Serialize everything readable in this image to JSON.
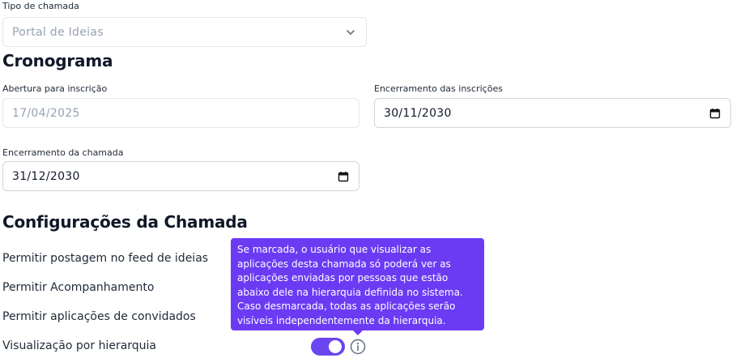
{
  "tipo_chamada": {
    "label": "Tipo de chamada",
    "value": "Portal de Ideias"
  },
  "cronograma": {
    "title": "Cronograma",
    "abertura": {
      "label": "Abertura para inscrição",
      "value": "17/04/2025"
    },
    "encerramento_inscricoes": {
      "label": "Encerramento das inscrições",
      "value": "30/11/2030"
    },
    "encerramento_chamada": {
      "label": "Encerramento da chamada",
      "value": "31/12/2030"
    }
  },
  "configuracoes": {
    "title": "Configurações da Chamada",
    "items": [
      {
        "label": "Permitir postagem no feed de ideias"
      },
      {
        "label": "Permitir Acompanhamento"
      },
      {
        "label": "Permitir aplicações de convidados"
      },
      {
        "label": "Visualização por hierarquia",
        "enabled": true
      }
    ],
    "tooltip": "Se marcada, o usuário que visualizar as aplicações desta chamada só poderá ver as aplicações enviadas por pessoas que estão abaixo dele na hierarquia definida no sistema. Caso desmarcada, todas as aplicações serão visíveis independentemente da hierarquia."
  },
  "colors": {
    "accent": "#6b3bf4",
    "border": "#d0d5dd",
    "muted_text": "#98a2b3"
  },
  "icons": {
    "select": "chevron-down-icon",
    "date": "calendar-icon",
    "info": "info-icon"
  }
}
